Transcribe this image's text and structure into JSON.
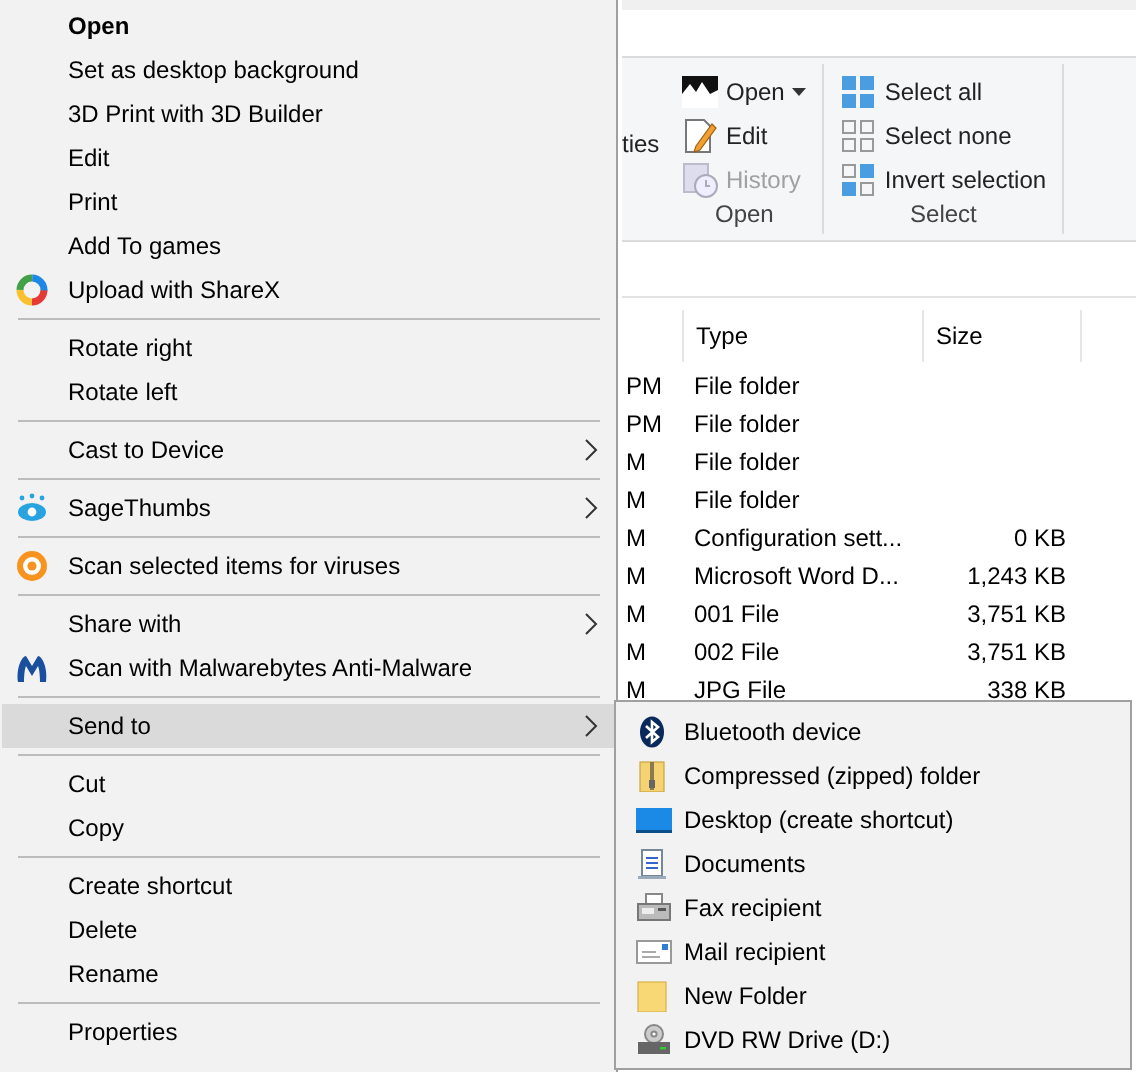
{
  "explorer": {
    "ribbon": {
      "partial_label": "ties",
      "groups": [
        {
          "label": "Open",
          "items": [
            {
              "label": "Open",
              "dropdown": true,
              "disabled": false
            },
            {
              "label": "Edit",
              "dropdown": false,
              "disabled": false
            },
            {
              "label": "History",
              "dropdown": false,
              "disabled": true
            }
          ]
        },
        {
          "label": "Select",
          "items": [
            {
              "label": "Select all",
              "dropdown": false,
              "disabled": false
            },
            {
              "label": "Select none",
              "dropdown": false,
              "disabled": false
            },
            {
              "label": "Invert selection",
              "dropdown": false,
              "disabled": false
            }
          ]
        }
      ]
    },
    "file_list": {
      "columns": [
        "Type",
        "Size"
      ],
      "rows": [
        {
          "column_1": "PM",
          "type": "File folder"
        },
        {
          "column_1": "PM",
          "type": "File folder"
        },
        {
          "column_1": "M",
          "type": "File folder"
        },
        {
          "column_1": "M",
          "type": "File folder"
        },
        {
          "column_1": "M",
          "type": "Configuration sett...",
          "size": "0 KB"
        },
        {
          "column_1": "M",
          "type": "Microsoft Word D...",
          "size": "1,243 KB"
        },
        {
          "column_1": "M",
          "type": "001 File",
          "size": "3,751 KB"
        },
        {
          "column_1": "M",
          "type": "002 File",
          "size": "3,751 KB"
        },
        {
          "column_1": "M",
          "type": "JPG File",
          "size": "338 KB"
        }
      ]
    }
  },
  "context_menu": {
    "items": [
      {
        "kind": "item",
        "label": "Open",
        "default": true,
        "submenu": false,
        "selected": false
      },
      {
        "kind": "item",
        "label": "Set as desktop background",
        "default": false,
        "submenu": false,
        "selected": false
      },
      {
        "kind": "item",
        "label": "3D Print with 3D Builder",
        "default": false,
        "submenu": false,
        "selected": false
      },
      {
        "kind": "item",
        "label": "Edit",
        "default": false,
        "submenu": false,
        "selected": false
      },
      {
        "kind": "item",
        "label": "Print",
        "default": false,
        "submenu": false,
        "selected": false
      },
      {
        "kind": "item",
        "label": "Add To games",
        "default": false,
        "submenu": false,
        "selected": false
      },
      {
        "kind": "item",
        "label": "Upload with ShareX",
        "default": false,
        "submenu": false,
        "selected": false
      },
      {
        "kind": "separator"
      },
      {
        "kind": "item",
        "label": "Rotate right",
        "default": false,
        "submenu": false,
        "selected": false
      },
      {
        "kind": "item",
        "label": "Rotate left",
        "default": false,
        "submenu": false,
        "selected": false
      },
      {
        "kind": "separator"
      },
      {
        "kind": "item",
        "label": "Cast to Device",
        "default": false,
        "submenu": true,
        "selected": false
      },
      {
        "kind": "separator"
      },
      {
        "kind": "item",
        "label": "SageThumbs",
        "default": false,
        "submenu": true,
        "selected": false
      },
      {
        "kind": "separator"
      },
      {
        "kind": "item",
        "label": "Scan selected items for viruses",
        "default": false,
        "submenu": false,
        "selected": false
      },
      {
        "kind": "separator"
      },
      {
        "kind": "item",
        "label": "Share with",
        "default": false,
        "submenu": true,
        "selected": false
      },
      {
        "kind": "item",
        "label": "Scan with Malwarebytes Anti-Malware",
        "default": false,
        "submenu": false,
        "selected": false
      },
      {
        "kind": "separator"
      },
      {
        "kind": "item",
        "label": "Send to",
        "default": false,
        "submenu": true,
        "selected": true
      },
      {
        "kind": "separator"
      },
      {
        "kind": "item",
        "label": "Cut",
        "default": false,
        "submenu": false,
        "selected": false
      },
      {
        "kind": "item",
        "label": "Copy",
        "default": false,
        "submenu": false,
        "selected": false
      },
      {
        "kind": "separator"
      },
      {
        "kind": "item",
        "label": "Create shortcut",
        "default": false,
        "submenu": false,
        "selected": false
      },
      {
        "kind": "item",
        "label": "Delete",
        "default": false,
        "submenu": false,
        "selected": false
      },
      {
        "kind": "item",
        "label": "Rename",
        "default": false,
        "submenu": false,
        "selected": false
      },
      {
        "kind": "separator"
      },
      {
        "kind": "item",
        "label": "Properties",
        "default": false,
        "submenu": false,
        "selected": false
      }
    ]
  },
  "send_to_menu": {
    "items": [
      {
        "label": "Bluetooth device"
      },
      {
        "label": "Compressed (zipped) folder"
      },
      {
        "label": "Desktop (create shortcut)"
      },
      {
        "label": "Documents"
      },
      {
        "label": "Fax recipient"
      },
      {
        "label": "Mail recipient"
      },
      {
        "label": "New Folder"
      },
      {
        "label": "DVD RW Drive (D:)"
      }
    ]
  }
}
